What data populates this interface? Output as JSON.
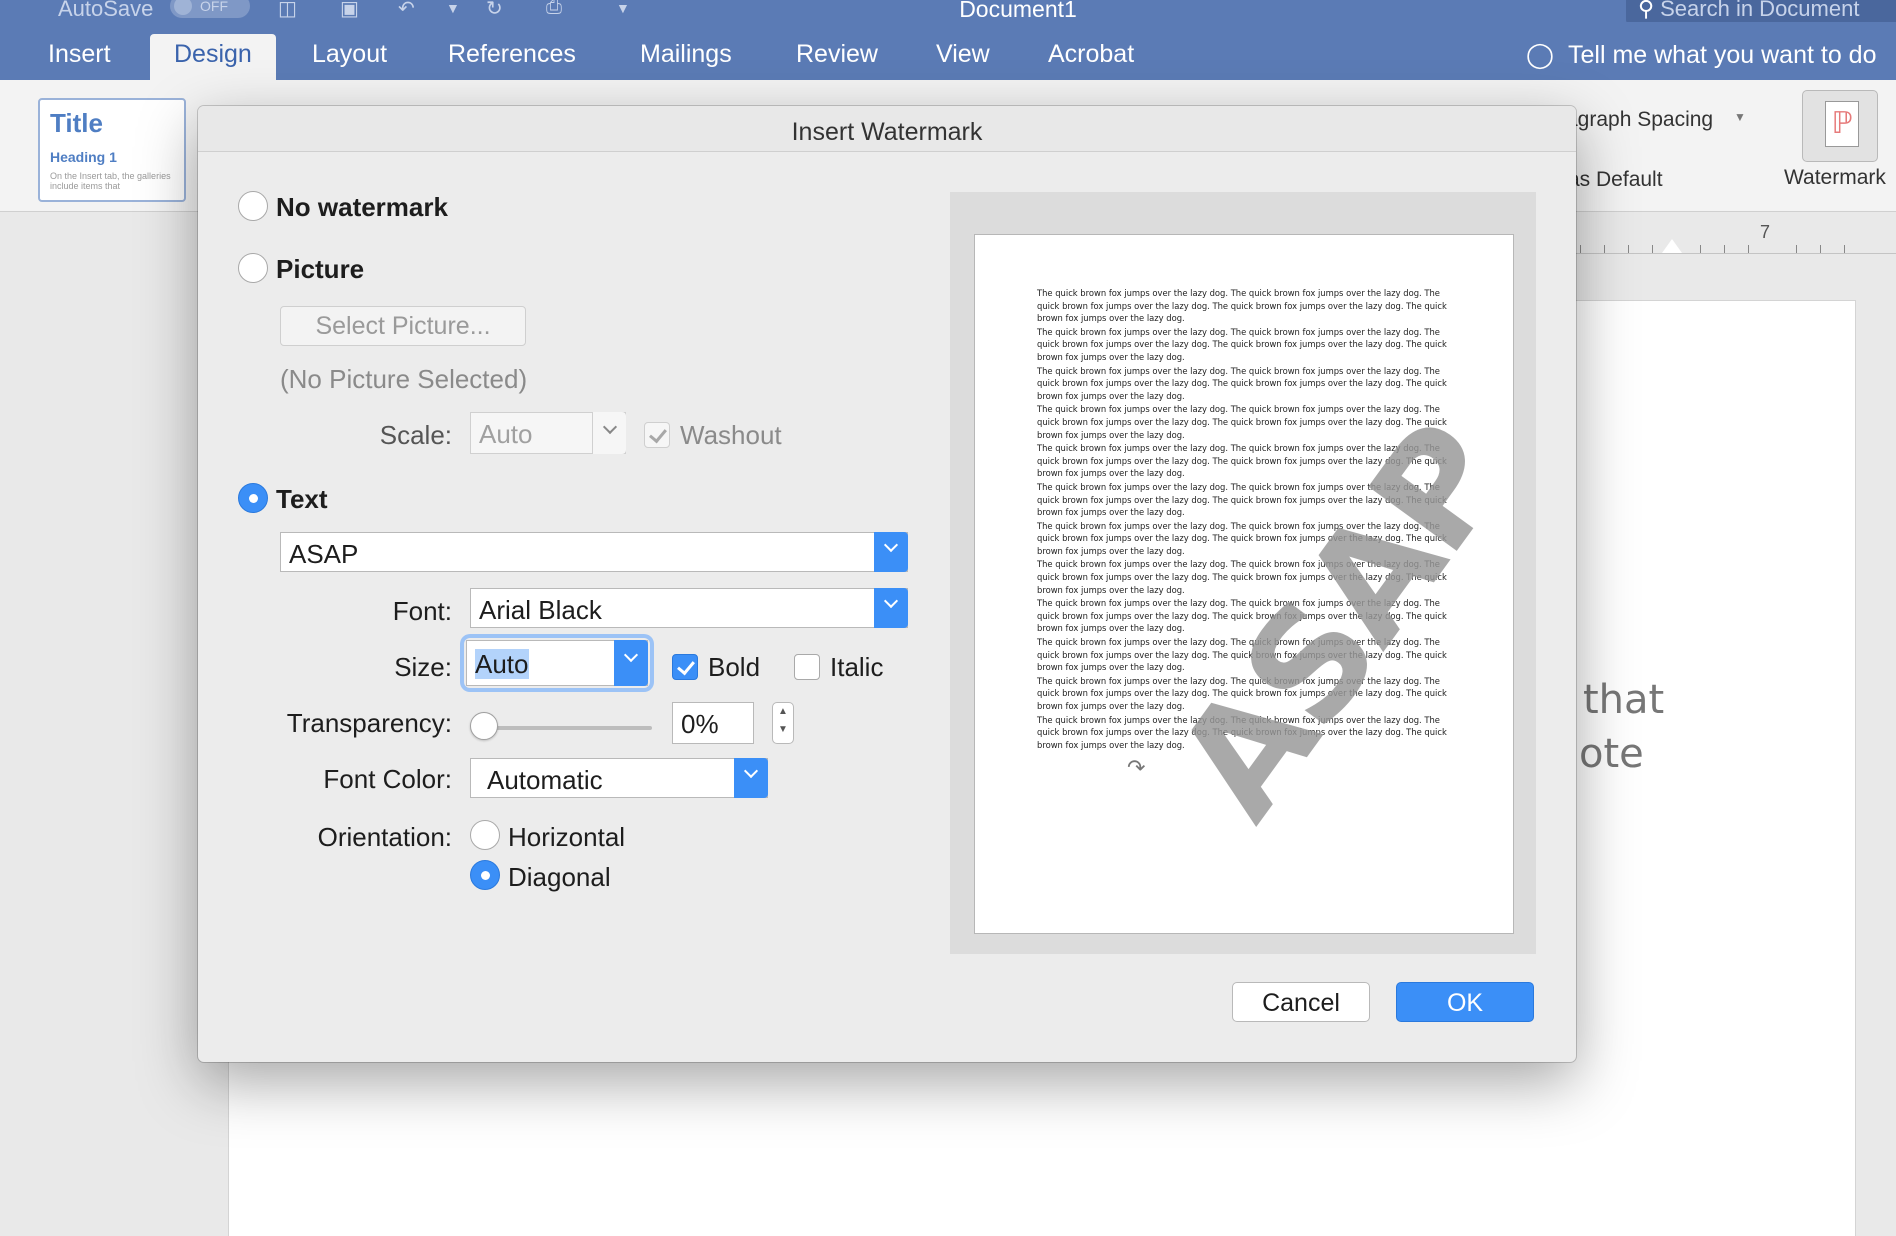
{
  "titlebar": {
    "autosave_label": "AutoSave",
    "autosave_state": "OFF",
    "document_title": "Document1",
    "search_placeholder": "Search in Document"
  },
  "ribbon_tabs": [
    {
      "label": "Insert"
    },
    {
      "label": "Design"
    },
    {
      "label": "Layout"
    },
    {
      "label": "References"
    },
    {
      "label": "Mailings"
    },
    {
      "label": "Review"
    },
    {
      "label": "View"
    },
    {
      "label": "Acrobat"
    }
  ],
  "active_tab": "Design",
  "tell_me": "Tell me what you want to do",
  "ribbon": {
    "style_title": "Title",
    "style_heading": "Heading 1",
    "style_body": "On the Insert tab, the galleries include items that",
    "paragraph_spacing": "agraph Spacing",
    "set_as_default": "as Default",
    "watermark_label": "Watermark"
  },
  "ruler": {
    "number": "7"
  },
  "document": {
    "line1": "that",
    "line2": "ote"
  },
  "dialog": {
    "title": "Insert Watermark",
    "no_watermark_label": "No watermark",
    "picture_label": "Picture",
    "select_picture_button": "Select Picture...",
    "no_picture_text": "(No Picture Selected)",
    "scale_label": "Scale:",
    "scale_value": "Auto",
    "washout_label": "Washout",
    "text_label": "Text",
    "text_value": "ASAP",
    "font_label": "Font:",
    "font_value": "Arial Black",
    "size_label": "Size:",
    "size_value": "Auto",
    "bold_label": "Bold",
    "italic_label": "Italic",
    "transparency_label": "Transparency:",
    "transparency_value": "0%",
    "transparency_level": 0,
    "font_color_label": "Font Color:",
    "font_color_value": "Automatic",
    "orientation_label": "Orientation:",
    "horizontal_label": "Horizontal",
    "diagonal_label": "Diagonal",
    "cancel_button": "Cancel",
    "ok_button": "OK",
    "selected_option": "text",
    "selected_orientation": "diagonal",
    "bold_checked": true,
    "italic_checked": false,
    "washout_checked": true
  },
  "preview": {
    "sample_line": "The quick brown fox jumps over the lazy dog. The quick brown fox jumps over the lazy dog. The quick brown fox jumps over the lazy dog. The quick brown fox jumps over the lazy dog. The quick brown fox jumps over the lazy dog.",
    "paragraph_count": 12,
    "watermark_text": "ASAP"
  },
  "colors": {
    "accent": "#3b8ff7",
    "titlebar": "#5b7bb5",
    "dialog_bg": "#ececec"
  }
}
